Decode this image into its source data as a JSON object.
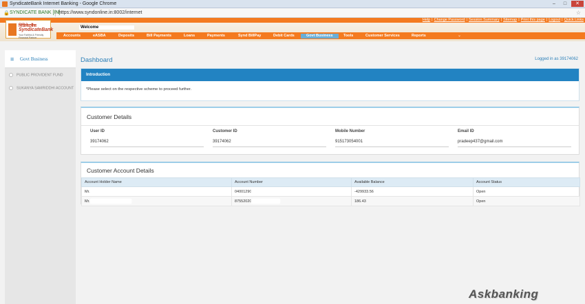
{
  "browser": {
    "window_title": "SyndicateBank Internet Banking - Google Chrome",
    "secure_label": "SYNDICATE BANK [IN]",
    "url": "https://www.syndonline.in:8002/internet"
  },
  "bank": {
    "logo_hindi": "सिंडिकेटबैंक",
    "logo_name": "SyndicateBank",
    "logo_tagline": "Your Faithful & Friendly Financial Partner",
    "welcome": "Welcome",
    "top_links": [
      "Help",
      "Change Password",
      "Session Summary",
      "Sitemap",
      "Print this page",
      "Logout",
      "Quick Links"
    ],
    "nav": [
      "Accounts",
      "eASBA",
      "Deposits",
      "Bill Payments",
      "Loans",
      "Payments",
      "Synd BillPay",
      "Debit Cards",
      "Govt Business",
      "Tools",
      "Customer Services",
      "Reports"
    ],
    "nav_active": "Govt Business"
  },
  "sidebar": {
    "heading": "Govt Business",
    "items": [
      "PUBLIC PROVIDENT FUND",
      "SUKANYA SAMRIDDHI ACCOUNT"
    ]
  },
  "dashboard": {
    "title": "Dashboard",
    "logged_in": "Logged in as 39174062"
  },
  "intro": {
    "heading": "Introduction",
    "message": "*Please select on the respective scheme to proceed further."
  },
  "customer_details": {
    "heading": "Customer Details",
    "user_id_label": "User ID",
    "user_id": "39174062",
    "customer_id_label": "Customer ID",
    "customer_id": "39174062",
    "mobile_label": "Mobile Number",
    "mobile": "915173054001",
    "email_label": "Email ID",
    "email": "pradeep437@gmail.com"
  },
  "accounts": {
    "heading": "Customer Account Details",
    "columns": [
      "Account Holder Name",
      "Account Number",
      "Available Balance",
      "Account Status"
    ],
    "rows": [
      {
        "holder": "Mr.",
        "number": "04001290",
        "balance": "-429933.56",
        "status": "Open"
      },
      {
        "holder": "Mr.",
        "number": "87552020",
        "balance": "186.43",
        "status": "Open"
      }
    ]
  },
  "watermark": "Askbanking"
}
